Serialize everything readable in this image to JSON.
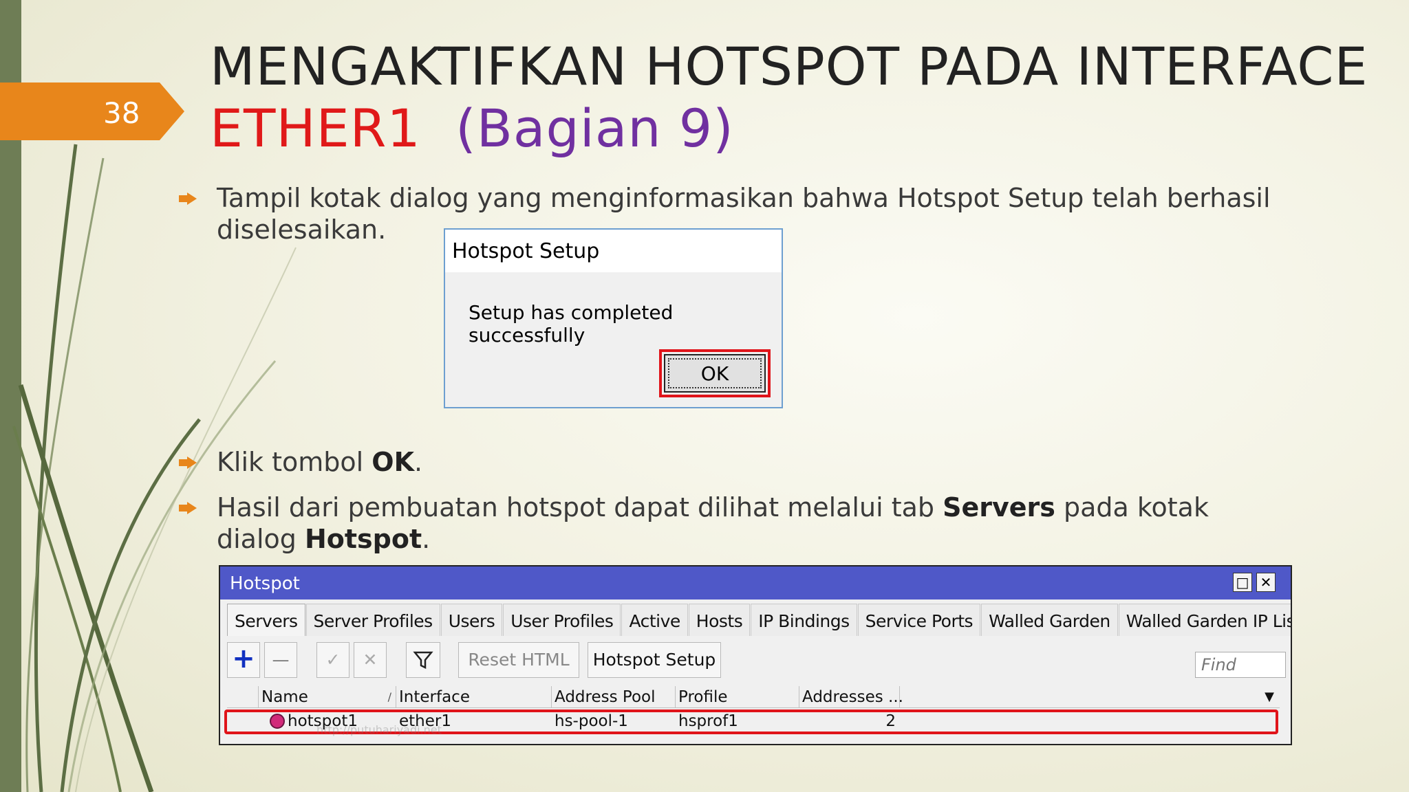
{
  "slide": {
    "number": "38",
    "title_line1": "MENGAKTIFKAN HOTSPOT PADA INTERFACE",
    "title_ether": "ETHER1",
    "title_part": "(Bagian 9)"
  },
  "bullets": {
    "b1": "Tampil kotak dialog yang menginformasikan bahwa Hotspot Setup telah berhasil diselesaikan.",
    "b2_prefix": "Klik tombol ",
    "b2_bold": "OK",
    "b2_suffix": ".",
    "b3_prefix": "Hasil dari pembuatan hotspot dapat dilihat melalui tab ",
    "b3_bold1": "Servers",
    "b3_mid": " pada kotak dialog ",
    "b3_bold2": "Hotspot",
    "b3_suffix": "."
  },
  "dialog": {
    "title": "Hotspot Setup",
    "message": "Setup has completed successfully",
    "ok_label": "OK"
  },
  "hotspot_window": {
    "title": "Hotspot",
    "restore_icon": "□",
    "close_icon": "✕",
    "tabs": [
      "Servers",
      "Server Profiles",
      "Users",
      "User Profiles",
      "Active",
      "Hosts",
      "IP Bindings",
      "Service Ports",
      "Walled Garden",
      "Walled Garden IP List",
      "..."
    ],
    "toolbar": {
      "add_icon": "+",
      "remove_icon": "—",
      "enable_icon": "✓",
      "disable_icon": "✕",
      "filter_icon": "filter",
      "reset_html": "Reset HTML",
      "hotspot_setup": "Hotspot Setup",
      "find_placeholder": "Find"
    },
    "columns": [
      "Name",
      "Interface",
      "Address Pool",
      "Profile",
      "Addresses ..."
    ],
    "sort_marker": "/",
    "rows": [
      {
        "icon": "hotspot-server-icon",
        "name": "hotspot1",
        "interface": "ether1",
        "address_pool": "hs-pool-1",
        "profile": "hsprof1",
        "addresses": "2"
      }
    ]
  },
  "watermark": "http://putuhariyadi.net"
}
